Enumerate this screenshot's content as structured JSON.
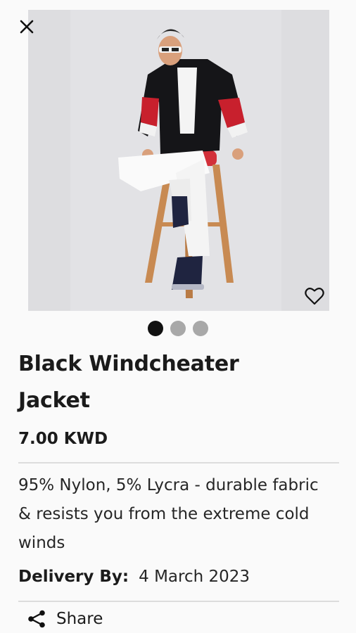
{
  "product": {
    "title": "Black Windcheater Jacket",
    "price": "7.00 KWD",
    "description": "95% Nylon, 5% Lycra - durable fabric & resists you from the extreme cold winds",
    "delivery_label": "Delivery By:",
    "delivery_date": "4 March 2023"
  },
  "carousel": {
    "image_count": 3,
    "active_index": 0
  },
  "actions": {
    "share_label": "Share"
  },
  "icons": {
    "close": "close-icon",
    "favorite": "heart-outline-icon",
    "share": "share-icon"
  },
  "colors": {
    "dot_active": "#111111",
    "dot_inactive": "#a8a8a8",
    "background": "#fafafa"
  }
}
